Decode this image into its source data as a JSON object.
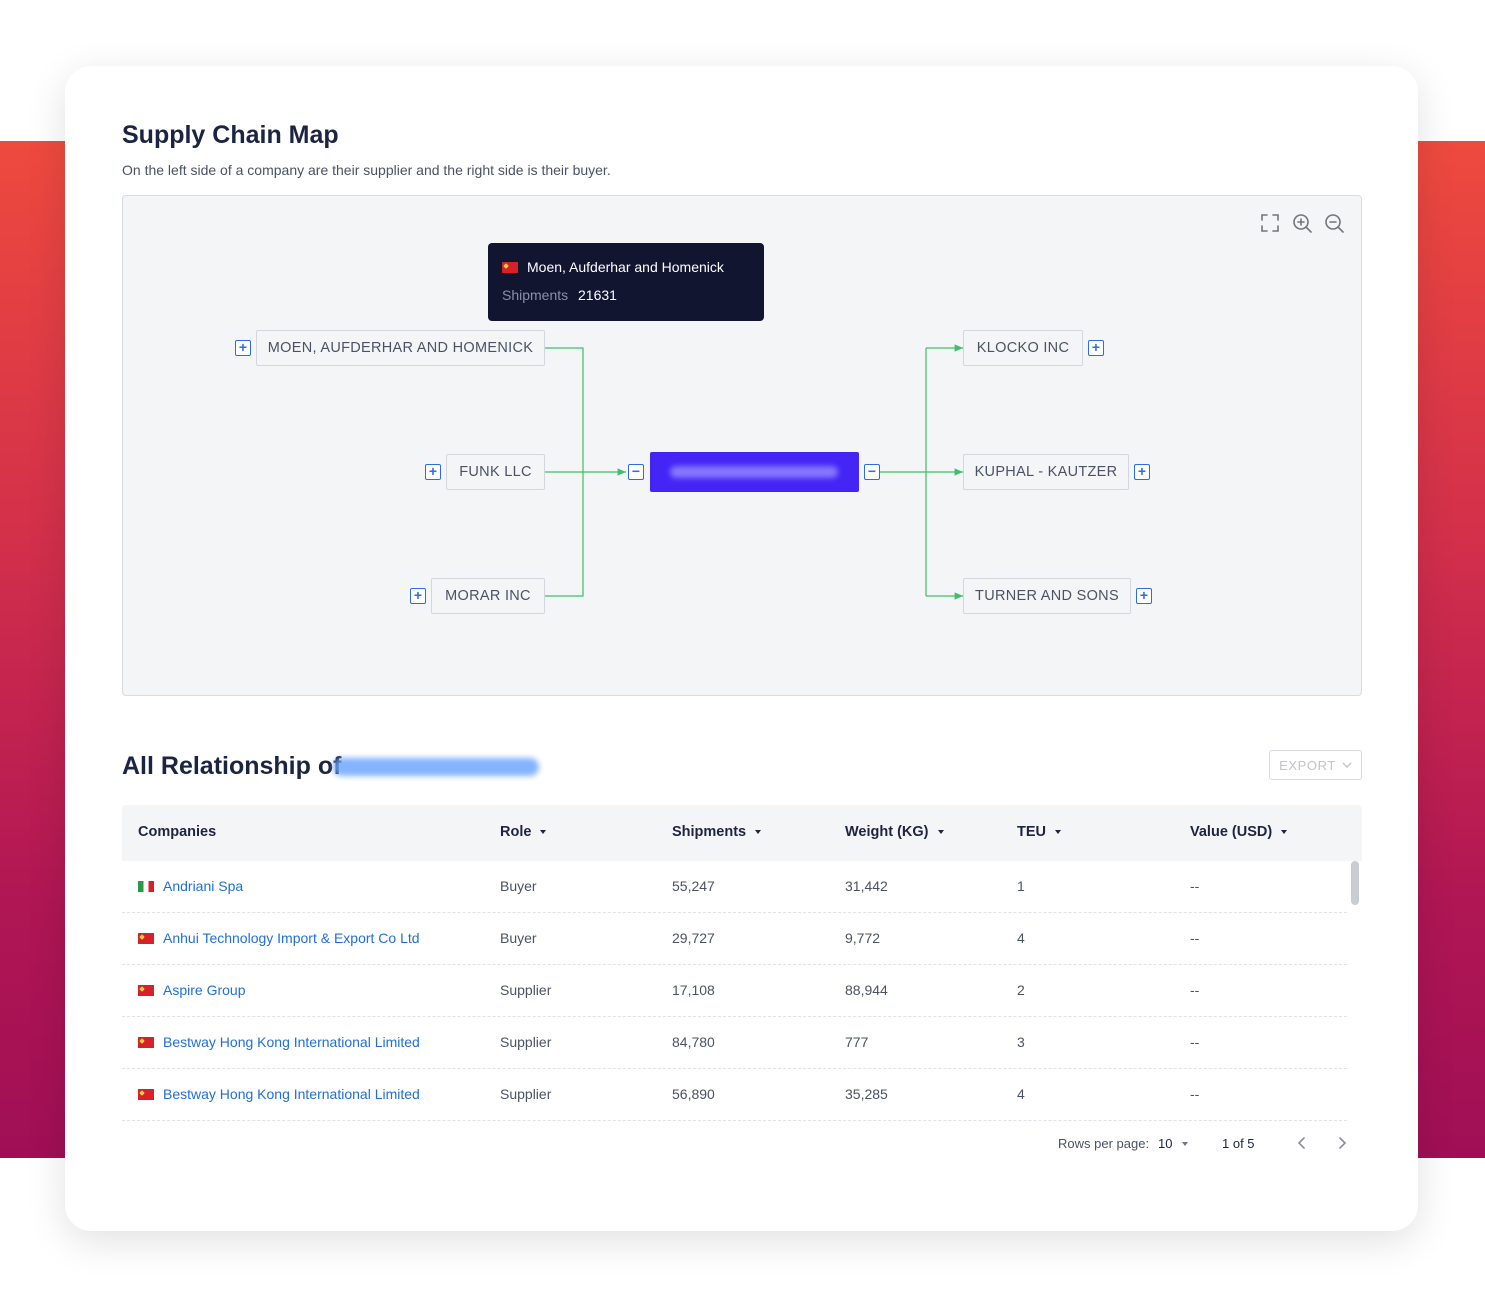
{
  "supply_chain_map": {
    "title": "Supply Chain Map",
    "subtitle": "On the left side of a company are their supplier and the right side is their buyer.",
    "toolbar": [
      "fullscreen-icon",
      "zoom-in-icon",
      "zoom-out-icon"
    ],
    "tooltip": {
      "flag": "cn",
      "name": "Moen, Aufderhar and Homenick",
      "shipments_label": "Shipments",
      "shipments_value": "21631"
    },
    "suppliers": [
      "MOEN, AUFDERHAR AND HOMENICK",
      "FUNK LLC",
      "MORAR INC"
    ],
    "buyers": [
      "KLOCKO INC",
      "KUPHAL - KAUTZER",
      "TURNER AND SONS"
    ],
    "center_company_redacted": true,
    "colors": {
      "center_node": "#4325f5",
      "edge": "#3fbf6a",
      "toggle": "#2e6ce6"
    }
  },
  "relationships": {
    "title": "All Relationship of",
    "export_label": "EXPORT",
    "columns": [
      "Companies",
      "Role",
      "Shipments",
      "Weight (KG)",
      "TEU",
      "Value (USD)"
    ],
    "rows": [
      {
        "flag": "it",
        "company": "Andriani Spa",
        "role": "Buyer",
        "shipments": "55,247",
        "weight": "31,442",
        "teu": "1",
        "value": "--"
      },
      {
        "flag": "cn",
        "company": "Anhui Technology Import & Export Co Ltd",
        "role": "Buyer",
        "shipments": "29,727",
        "weight": "9,772",
        "teu": "4",
        "value": "--"
      },
      {
        "flag": "cn",
        "company": "Aspire Group",
        "role": "Supplier",
        "shipments": "17,108",
        "weight": "88,944",
        "teu": "2",
        "value": "--"
      },
      {
        "flag": "cn",
        "company": "Bestway Hong Kong International Limited",
        "role": "Supplier",
        "shipments": "84,780",
        "weight": "777",
        "teu": "3",
        "value": "--"
      },
      {
        "flag": "cn",
        "company": "Bestway Hong Kong International Limited",
        "role": "Supplier",
        "shipments": "56,890",
        "weight": "35,285",
        "teu": "4",
        "value": "--"
      }
    ],
    "pagination": {
      "rows_per_page_label": "Rows per page:",
      "rows_per_page_value": "10",
      "page_info": "1 of 5"
    }
  }
}
